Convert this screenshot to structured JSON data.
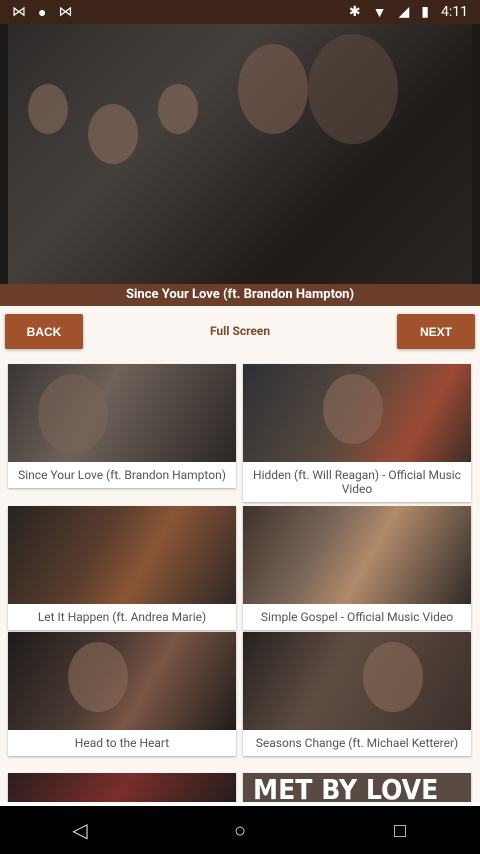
{
  "status_bar": {
    "time": "4:11",
    "icons_left": [
      "m-logo-icon",
      "circle-icon",
      "m-logo-icon"
    ],
    "icons_right": [
      "bluetooth-icon",
      "wifi-icon",
      "signal-icon",
      "battery-icon"
    ]
  },
  "player": {
    "now_playing": "Since Your Love (ft. Brandon Hampton)"
  },
  "controls": {
    "back_label": "BACK",
    "fullscreen_label": "Full Screen",
    "next_label": "NEXT"
  },
  "videos": [
    {
      "title": "Since Your Love (ft. Brandon Hampton)"
    },
    {
      "title": "Hidden (ft. Will Reagan)  - Official Music Video"
    },
    {
      "title": "Let It Happen (ft. Andrea Marie)"
    },
    {
      "title": "Simple Gospel - Official Music Video"
    },
    {
      "title": "Head to the Heart"
    },
    {
      "title": "Seasons Change (ft. Michael Ketterer)"
    },
    {
      "title": ""
    },
    {
      "title": "",
      "thumb_text": "MET BY LOVE"
    }
  ],
  "nav": {
    "back_icon": "back-triangle-icon",
    "home_icon": "home-circle-icon",
    "recents_icon": "recents-square-icon"
  },
  "colors": {
    "status_bar_bg": "#3d2418",
    "caption_bg": "#6b3d2b",
    "button_bg": "#a0522d",
    "accent_text": "#7a4a2a"
  }
}
